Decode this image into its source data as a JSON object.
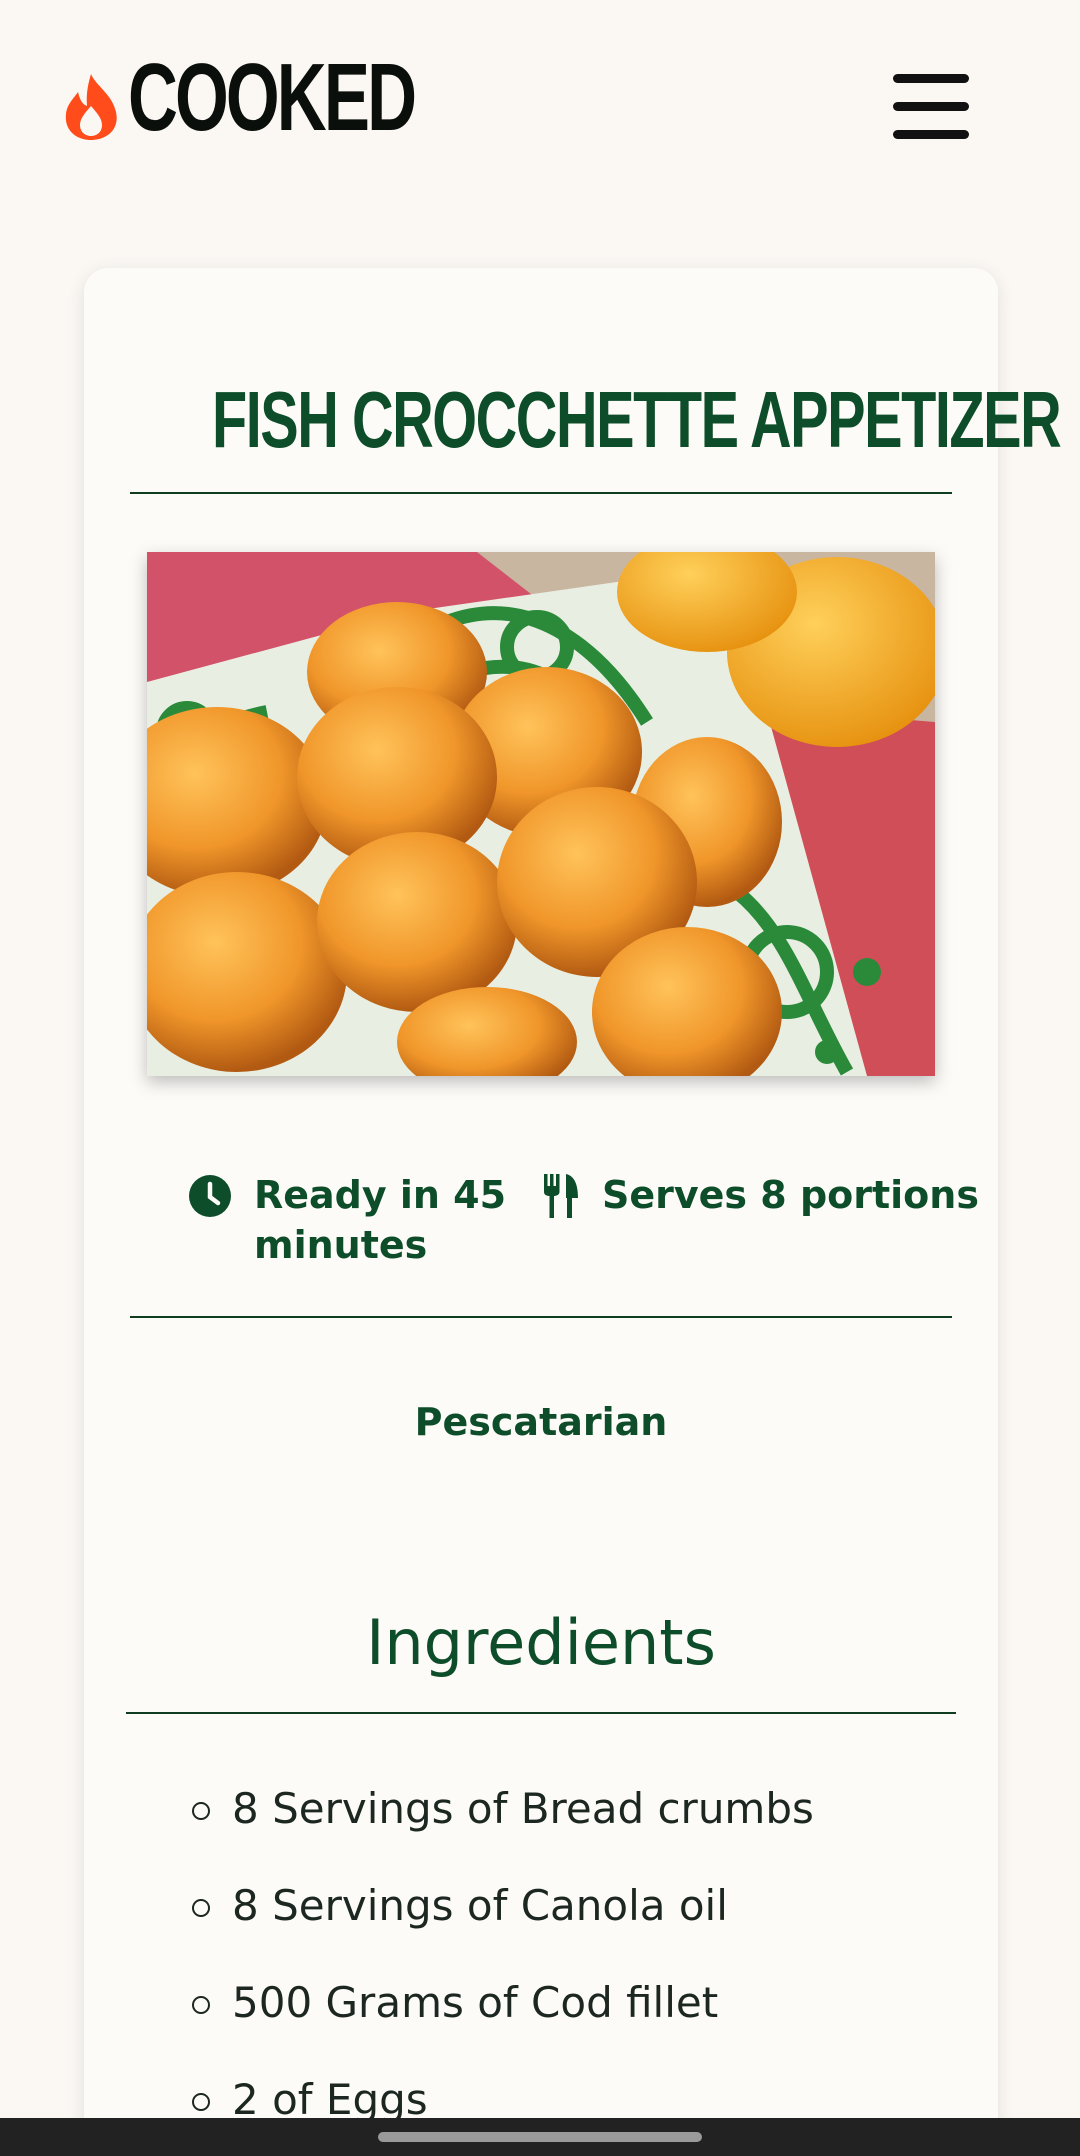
{
  "brand": {
    "name": "COOKED",
    "accent_color": "#ff4c1a",
    "dark_color": "#0b0f0c"
  },
  "header": {
    "menu_icon": "hamburger-menu-icon"
  },
  "recipe": {
    "title": "FISH CROCCHETTE APPETIZER",
    "title_color": "#0e4d2a",
    "ready_text": "Ready in 45",
    "ready_text_2": "minutes",
    "ready_icon": "clock-icon",
    "serves_text": "Serves 8 portions",
    "serves_icon": "fork-knife-icon",
    "diet": "Pescatarian"
  },
  "ingredients": {
    "title": "Ingredients",
    "items": [
      "8 Servings of Bread crumbs",
      "8 Servings of Canola oil",
      "500 Grams of Cod fillet",
      "2 of Eggs"
    ]
  }
}
